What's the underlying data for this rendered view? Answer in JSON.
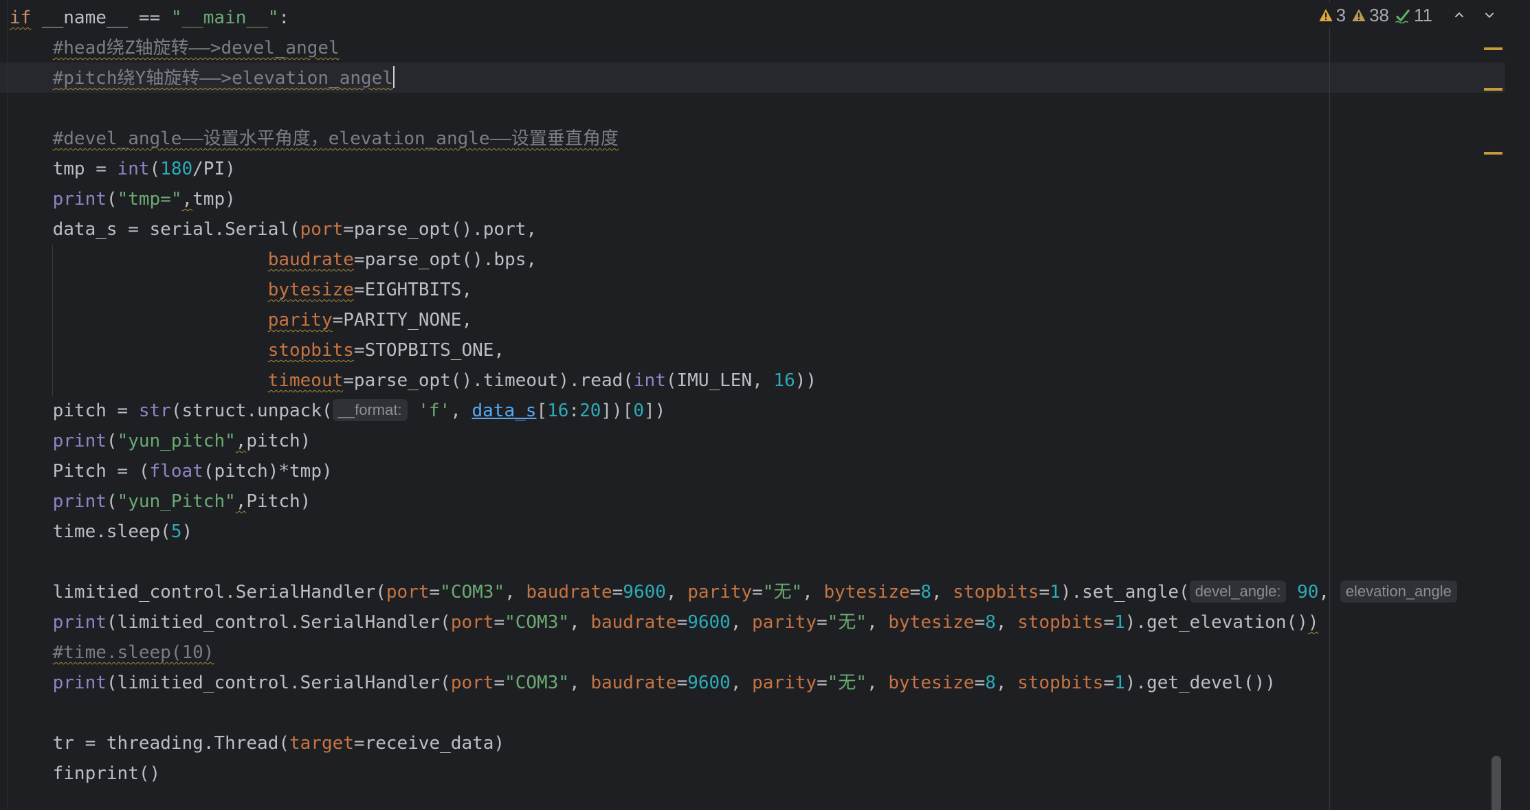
{
  "inspections": {
    "warnings_a": "3",
    "warnings_b": "38",
    "weak_warnings": "11",
    "prev_label": "previous highlighted error",
    "next_label": "next highlighted error"
  },
  "code": {
    "l1_if": "if",
    "l1_name": " __name__ == ",
    "l1_main": "\"__main__\"",
    "l1_colon": ":",
    "l2_comment": "#head绕Z轴旋转——>devel_angel",
    "l3_comment": "#pitch绕Y轴旋转——>elevation_angel",
    "l5_comment": "#devel_angle——设置水平角度，elevation_angle——设置垂直角度",
    "l6_tmp": "tmp = ",
    "l6_int": "int",
    "l6_open": "(",
    "l6_180": "180",
    "l6_rest": "/PI)",
    "l7_print": "print",
    "l7_open": "(",
    "l7_str": "\"tmp=\"",
    "l7_comma": ",",
    "l7_rest": "tmp)",
    "l8_a": "data_s = serial.Serial(",
    "l8_port": "port",
    "l8_rest": "=parse_opt().port,",
    "l9_baud": "baudrate",
    "l9_rest": "=parse_opt().bps,",
    "l10_bytesize": "bytesize",
    "l10_rest": "=EIGHTBITS,",
    "l11_parity": "parity",
    "l11_rest": "=PARITY_NONE,",
    "l12_stopbits": "stopbits",
    "l12_rest": "=STOPBITS_ONE,",
    "l13_timeout": "timeout",
    "l13_mid": "=parse_opt().timeout).read(",
    "l13_int": "int",
    "l13_imu": "(IMU_LEN, ",
    "l13_16": "16",
    "l13_close": "))",
    "l14_a": "pitch = ",
    "l14_str": "str",
    "l14_b": "(struct.unpack(",
    "l14_hint": "__format:",
    "l14_f": "'f'",
    "l14_c": ", ",
    "l14_data": "data_s",
    "l14_d": "[",
    "l14_16": "16",
    "l14_e": ":",
    "l14_20": "20",
    "l14_f2": "])[",
    "l14_0": "0",
    "l14_g": "])",
    "l15_print": "print",
    "l15_open": "(",
    "l15_str": "\"yun_pitch\"",
    "l15_comma": ",",
    "l15_rest": "pitch)",
    "l16_a": "Pitch = (",
    "l16_float": "float",
    "l16_rest": "(pitch)*tmp)",
    "l17_print": "print",
    "l17_open": "(",
    "l17_str": "\"yun_Pitch\"",
    "l17_comma": ",",
    "l17_rest": "Pitch)",
    "l18_a": "time.sleep(",
    "l18_5": "5",
    "l18_close": ")",
    "l20_a": "limitied_control.SerialHandler(",
    "port": "port",
    "eq": "=",
    "com3": "\"COM3\"",
    "sep": ", ",
    "baudrate": "baudrate",
    "n9600": "9600",
    "parity": "parity",
    "wu": "\"无\"",
    "bytesize": "bytesize",
    "n8": "8",
    "stopbits": "stopbits",
    "n1": "1",
    "l20_set": ").set_angle(",
    "l20_hint1": "devel_angle:",
    "l20_90": "90",
    "l20_comma": ",",
    "l20_hint2": "elevation_angle",
    "l21_print": "print",
    "l21_a": "(limitied_control.SerialHandler(",
    "l21_end": ").get_elevation()",
    "l21_close": ")",
    "l22_comment": "#time.sleep(10)",
    "l23_print": "print",
    "l23_a": "(limitied_control.SerialHandler(",
    "l23_end": ").get_devel())",
    "l25_a": "tr = threading.Thread(",
    "l25_target": "target",
    "l25_rest": "=receive_data)",
    "l26": "finprint()"
  },
  "colors": {
    "background": "#1e1f22",
    "keyword": "#cf8e6d",
    "builtin": "#8888c6",
    "string": "#6aab73",
    "number": "#2aacb8",
    "comment": "#7a7e85",
    "parameter": "#c77443",
    "warning": "#c99a38"
  }
}
